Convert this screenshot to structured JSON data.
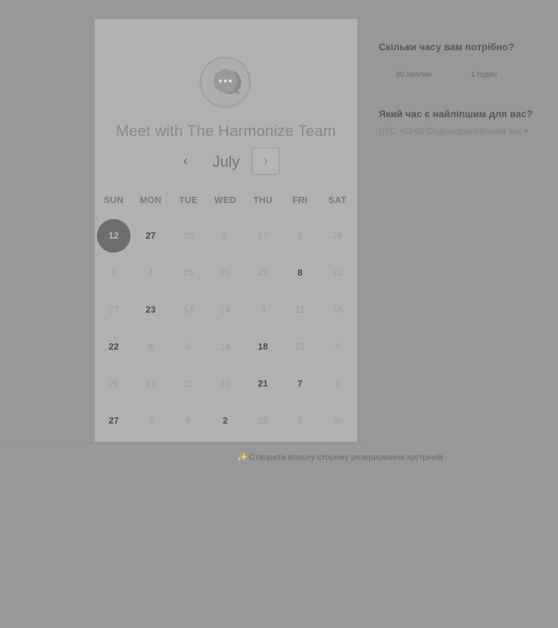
{
  "booking": {
    "title": "Meet with The Harmonize Team",
    "month": "July",
    "prev_icon": "‹",
    "next_icon": "›"
  },
  "weekdays": [
    "SUN",
    "MON",
    "TUE",
    "WED",
    "THU",
    "FRI",
    "SAT"
  ],
  "calendar": {
    "rows": [
      [
        "12",
        "27",
        "26",
        "6",
        "17",
        "2",
        "28"
      ],
      [
        "8",
        "4",
        "25",
        "20",
        "29",
        "8",
        "31"
      ],
      [
        "27",
        "23",
        "14",
        "24",
        "3",
        "11",
        "15"
      ],
      [
        "22",
        "8",
        "5",
        "16",
        "18",
        "22",
        "8"
      ],
      [
        "26",
        "31",
        "11",
        "31",
        "21",
        "7",
        "2"
      ],
      [
        "27",
        "9",
        "6",
        "2",
        "26",
        "3",
        "30"
      ]
    ],
    "available": [
      [
        0,
        1
      ],
      [
        1,
        5
      ],
      [
        2,
        1
      ],
      [
        3,
        0
      ],
      [
        3,
        4
      ],
      [
        4,
        4
      ],
      [
        4,
        5
      ],
      [
        5,
        0
      ],
      [
        5,
        3
      ]
    ],
    "selected": [
      0,
      0
    ]
  },
  "panel": {
    "duration_question": "Скільки часу вам потрібно?",
    "durations": [
      "30 хвилин",
      "1 годин"
    ],
    "time_question": "Який час є найліпшим для вас?",
    "timezone": "UTC +03:00 Східноєвропейський час",
    "slots": [
      "9:00 am",
      "9:30 am",
      "1:00 pm",
      "2:00 pm",
      "2:30 pm",
      "3:00 pm",
      "3:30 pm"
    ]
  },
  "footer": {
    "icon": "✨",
    "text": "Створити власну сторінку резервування зустрічей"
  }
}
